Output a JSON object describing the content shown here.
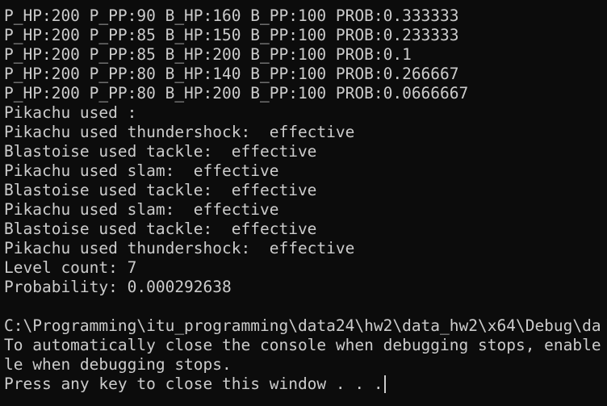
{
  "console": {
    "lines": [
      "P_HP:200 P_PP:90 B_HP:160 B_PP:100 PROB:0.333333",
      "P_HP:200 P_PP:85 B_HP:150 B_PP:100 PROB:0.233333",
      "P_HP:200 P_PP:85 B_HP:200 B_PP:100 PROB:0.1",
      "P_HP:200 P_PP:80 B_HP:140 B_PP:100 PROB:0.266667",
      "P_HP:200 P_PP:80 B_HP:200 B_PP:100 PROB:0.0666667",
      "Pikachu used :",
      "Pikachu used thundershock:  effective",
      "Blastoise used tackle:  effective",
      "Pikachu used slam:  effective",
      "Blastoise used tackle:  effective",
      "Pikachu used slam:  effective",
      "Blastoise used tackle:  effective",
      "Pikachu used thundershock:  effective",
      "Level count: 7",
      "Probability: 0.000292638",
      "",
      "C:\\Programming\\itu_programming\\data24\\hw2\\data_hw2\\x64\\Debug\\da",
      "To automatically close the console when debugging stops, enable",
      "le when debugging stops."
    ],
    "prompt": "Press any key to close this window . . .",
    "colors": {
      "background": "#0c0c0c",
      "foreground": "#cccccc"
    }
  }
}
